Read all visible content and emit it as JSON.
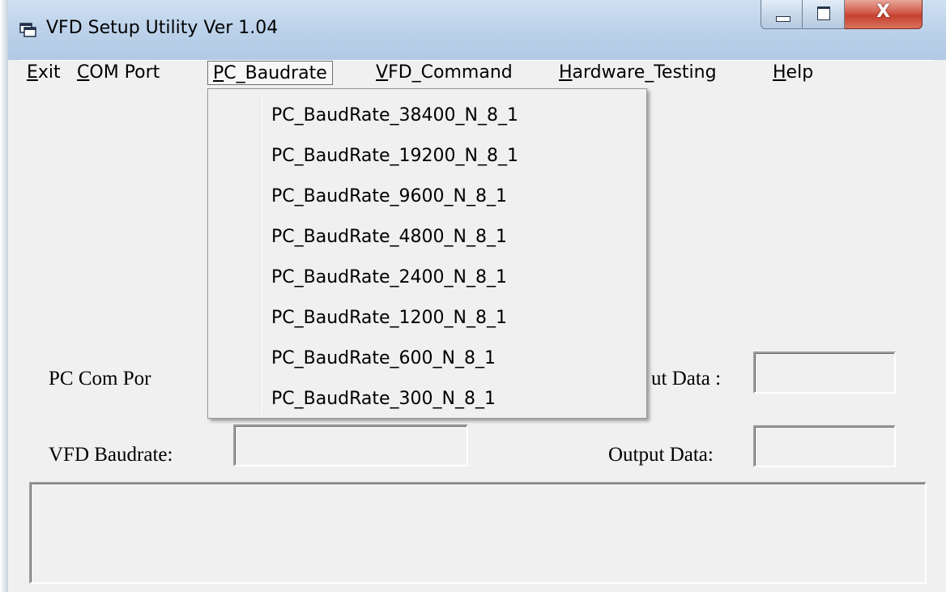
{
  "window": {
    "title": "VFD Setup Utility Ver 1.04",
    "controls": {
      "minimize": "minimize-icon",
      "maximize": "maximize-icon",
      "close_glyph": "X"
    }
  },
  "menubar": {
    "items": [
      {
        "label": "Exit",
        "accel": "E",
        "rest": "xit"
      },
      {
        "label": "COM Port",
        "accel": "C",
        "rest": "OM Port"
      },
      {
        "label": "PC_Baudrate",
        "accel": "P",
        "rest": "C_Baudrate",
        "open": true
      },
      {
        "label": "VFD_Command",
        "accel": "V",
        "rest": "FD_Command"
      },
      {
        "label": "Hardware_Testing",
        "accel": "H",
        "rest": "ardware_Testing"
      },
      {
        "label": "Help",
        "accel": "H",
        "rest": "elp"
      }
    ]
  },
  "dropdown": {
    "items": [
      "PC_BaudRate_38400_N_8_1",
      "PC_BaudRate_19200_N_8_1",
      "PC_BaudRate_9600_N_8_1",
      "PC_BaudRate_4800_N_8_1",
      "PC_BaudRate_2400_N_8_1",
      "PC_BaudRate_1200_N_8_1",
      "PC_BaudRate_600_N_8_1",
      "PC_BaudRate_300_N_8_1"
    ]
  },
  "form": {
    "pc_com_port_label": "PC  Com  Por",
    "input_data_label": "ut  Data :",
    "vfd_baudrate_label": "VFD Baudrate:",
    "output_data_label": "Output Data:",
    "vfd_baudrate_value": "",
    "input_data_value": "",
    "output_data_value": "",
    "log_text": ""
  }
}
